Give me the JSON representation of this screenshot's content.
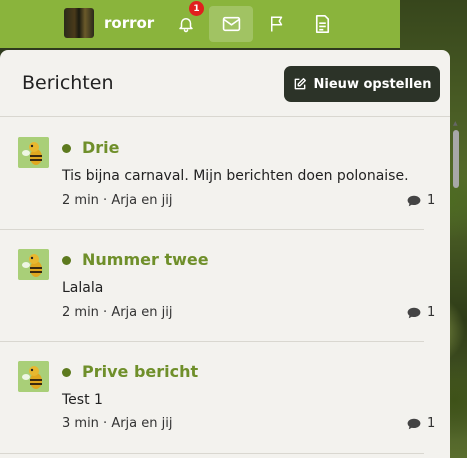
{
  "topbar": {
    "username": "rorror",
    "notification_count": "1",
    "icons": [
      "bell-icon",
      "mail-icon",
      "flag-icon",
      "document-icon"
    ]
  },
  "panel": {
    "title": "Berichten",
    "compose_label": "Nieuw opstellen"
  },
  "messages": [
    {
      "title": "Drie",
      "text": "Tis bijna carnaval. Mijn berichten doen polonaise.",
      "meta": "2 min · Arja en jij",
      "count": "1"
    },
    {
      "title": "Nummer twee",
      "text": "Lalala",
      "meta": "2 min · Arja en jij",
      "count": "1"
    },
    {
      "title": "Prive bericht",
      "text": "Test 1",
      "meta": "3 min · Arja en jij",
      "count": "1"
    }
  ],
  "colors": {
    "accent_green": "#8ab43c",
    "title_green": "#6f8f2a",
    "dark_button": "#2c3328",
    "badge_red": "#e0201e"
  }
}
